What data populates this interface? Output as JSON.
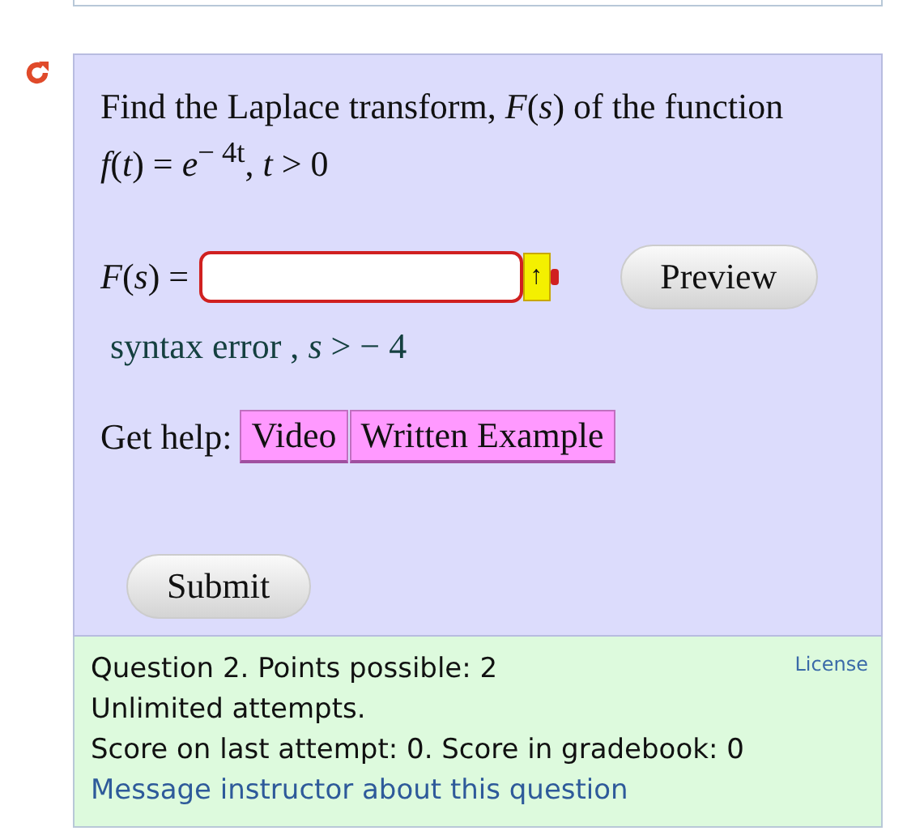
{
  "question": {
    "prompt": "Find the Laplace transform, *F*(*s*) of the function",
    "formula": "*f*(*t*) = *e*$^{− 4t}$,  *t* > 0",
    "answer_label": "*F*(*s*) =",
    "answer_field": {
      "error": true
    },
    "preview_toggle": "↑",
    "preview_button": "Preview",
    "feedback": "syntax error , *s* >  − 4",
    "help_label": "Get help:",
    "help_buttons": [
      "Video",
      "Written Example"
    ],
    "submit_button": "Submit"
  },
  "footer": {
    "license": "License",
    "lines": [
      "Question 2. Points possible: 2",
      "Unlimited attempts.",
      "Score on last attempt: 0. Score in gradebook: 0"
    ],
    "message_link": "Message instructor about this question"
  }
}
